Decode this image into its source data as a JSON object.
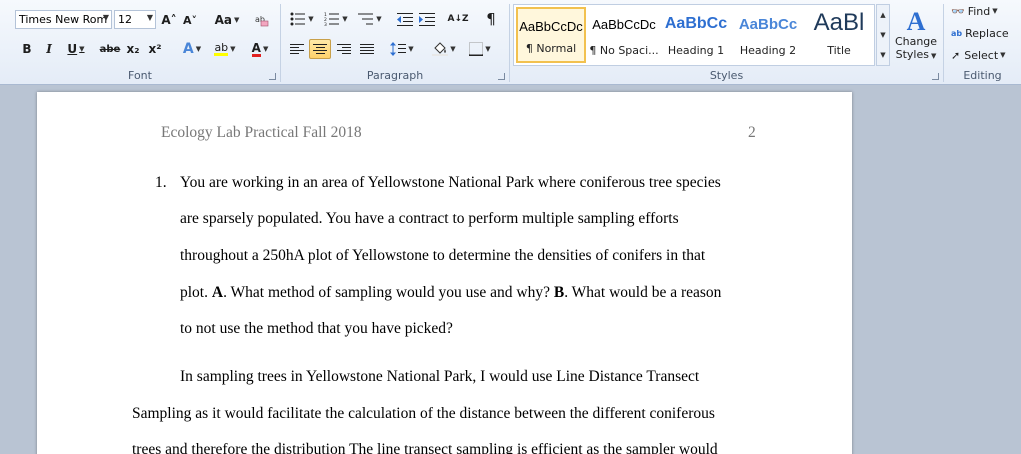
{
  "ribbon": {
    "font": {
      "label": "Font",
      "font_name": "Times New Rom",
      "font_size": "12",
      "grow_icon": "A˄",
      "shrink_icon": "A˅",
      "change_case": "Aa",
      "bold": "B",
      "italic": "I",
      "underline": "U",
      "strikethrough": "abe",
      "subscript": "x₂",
      "superscript": "x²",
      "text_effects": "A",
      "highlight": "ab",
      "font_color": "A",
      "highlight_color": "#ffff00",
      "font_color_value": "#e02020"
    },
    "paragraph": {
      "label": "Paragraph",
      "show_marks": "¶",
      "sort": "A↓Z",
      "active_alignment": "center"
    },
    "styles": {
      "label": "Styles",
      "items": [
        {
          "sample": "AaBbCcDc",
          "name": "¶ Normal",
          "selected": true
        },
        {
          "sample": "AaBbCcDc",
          "name": "¶ No Spaci...",
          "selected": false
        },
        {
          "sample": "AaBbCc",
          "name": "Heading 1",
          "selected": false
        },
        {
          "sample": "AaBbCc",
          "name": "Heading 2",
          "selected": false
        },
        {
          "sample": "AaBl",
          "name": "Title",
          "selected": false
        }
      ],
      "change_styles_line1": "Change",
      "change_styles_line2": "Styles"
    },
    "editing": {
      "label": "Editing",
      "find": "Find",
      "replace": "Replace",
      "select": "Select"
    }
  },
  "document": {
    "header_title": "Ecology Lab Practical Fall 2018",
    "page_number": "2",
    "list_number": "1.",
    "q_line1": "You are working in an area of Yellowstone National Park where coniferous tree species",
    "q_line2": "are sparsely populated. You have a contract to perform multiple sampling  efforts",
    "q_line3": "throughout a 250hA plot of Yellowstone to determine the densities of conifers in that",
    "q_line4_a": "plot. ",
    "q_line4_b1": "A",
    "q_line4_c": ". What method of sampling  would you use and why?  ",
    "q_line4_b2": "B",
    "q_line4_d": ". What would be a reason",
    "q_line5": "to not use the method that you have picked?",
    "a_line1": "In sampling  trees in  Yellowstone National Park, I would use Line Distance Transect",
    "a_line2": "Sampling as it would facilitate the calculation of the distance between the different coniferous",
    "a_line3": "trees  and therefore  the distribution  The line transect sampling  is efficient as the sampler would"
  },
  "colors": {
    "workspace": "#b9c4d3",
    "accent_selection": "#f2c14f",
    "heading_blue": "#2e6fd1"
  }
}
